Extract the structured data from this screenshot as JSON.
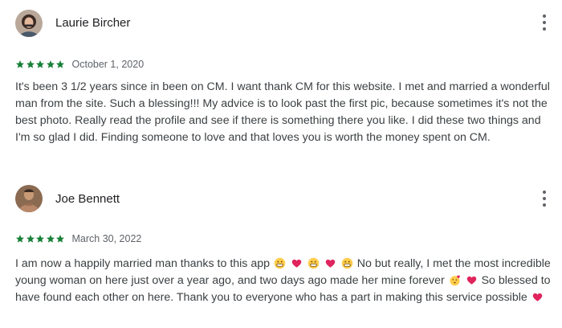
{
  "reviews": [
    {
      "author": "Laurie Bircher",
      "avatar_icon": "user-photo",
      "rating": 5,
      "date": "October 1, 2020",
      "text": "It's been 3 1/2 years since in been on CM. I want thank CM for this website. I met and married a wonderful man from the site. Such a blessing!!! My advice is to look past the first pic, because sometimes it's not the best photo. Really read the profile and see if there is something there you like. I did these two things and I'm so glad I did. Finding someone to love and that loves you is worth the money spent on CM."
    },
    {
      "author": "Joe Bennett",
      "avatar_icon": "user-photo",
      "rating": 5,
      "date": "March 30, 2022",
      "text_parts": [
        "I am now a happily married man thanks to this app",
        "No but really, I met the most incredible young woman on here just over a year ago, and two days ago made her mine forever",
        "So blessed to have found each other on here. Thank you to everyone who has a part in making this service possible"
      ]
    }
  ],
  "colors": {
    "star": "#188038",
    "author": "#202124",
    "text": "#3c4043",
    "meta": "#5f6368",
    "heart": "#e0245e"
  }
}
